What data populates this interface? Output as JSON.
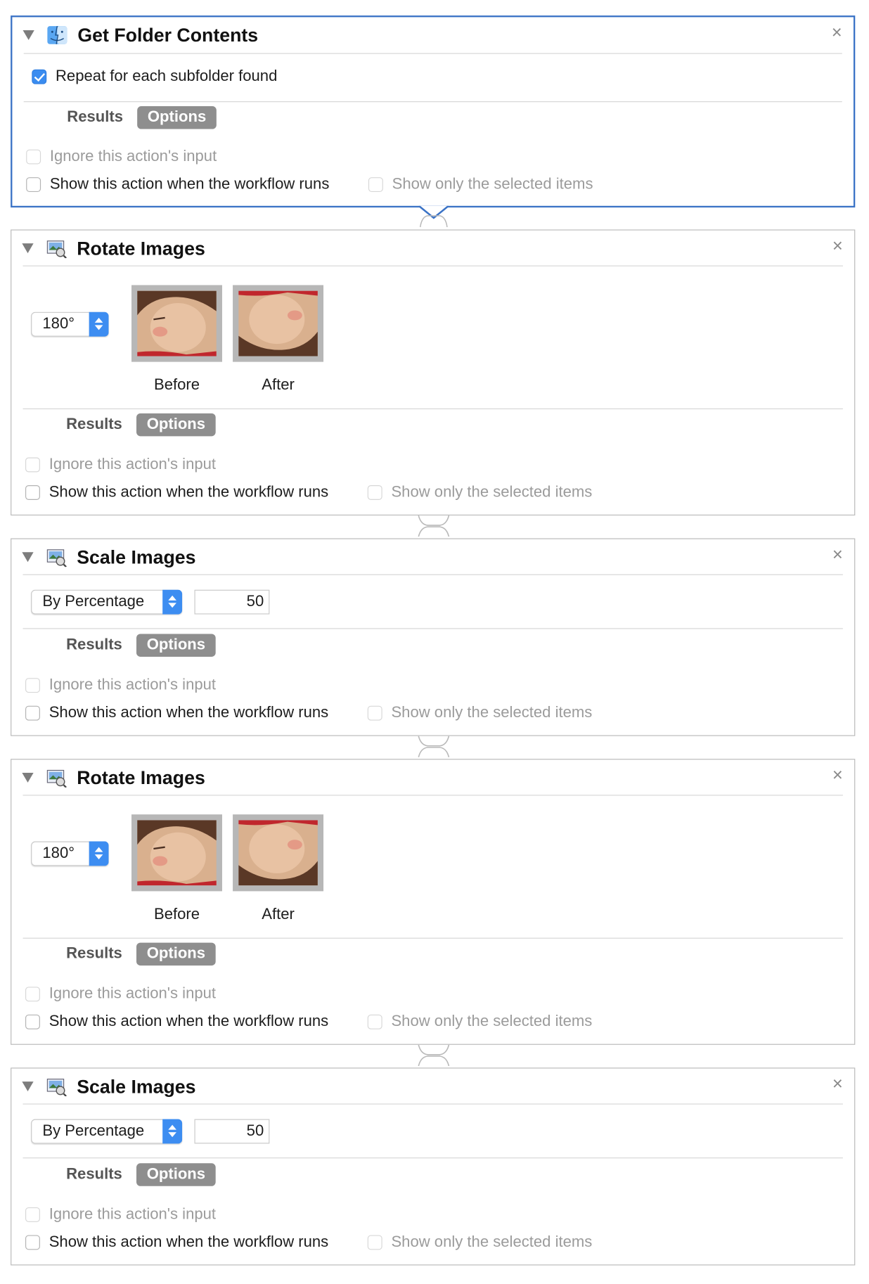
{
  "common": {
    "results_tab": "Results",
    "options_tab": "Options",
    "ignore_input": "Ignore this action's input",
    "show_action": "Show this action when the workflow runs",
    "show_only": "Show only the selected items",
    "close_glyph": "×"
  },
  "actions": [
    {
      "title": "Get Folder Contents",
      "icon": "finder-icon",
      "repeat_label": "Repeat for each subfolder found",
      "repeat_checked": true,
      "selected": true
    },
    {
      "title": "Rotate Images",
      "icon": "preview-icon",
      "rotation": "180°",
      "before_label": "Before",
      "after_label": "After"
    },
    {
      "title": "Scale Images",
      "icon": "preview-icon",
      "scale_mode": "By Percentage",
      "scale_value": "50"
    },
    {
      "title": "Rotate Images",
      "icon": "preview-icon",
      "rotation": "180°",
      "before_label": "Before",
      "after_label": "After"
    },
    {
      "title": "Scale Images",
      "icon": "preview-icon",
      "scale_mode": "By Percentage",
      "scale_value": "50"
    }
  ],
  "colors": {
    "selection_border": "#3b73c6",
    "checkbox_checked": "#3a8cf0",
    "popup_arrow": "#3d8df1",
    "options_tab_bg": "#8e8e8e"
  }
}
